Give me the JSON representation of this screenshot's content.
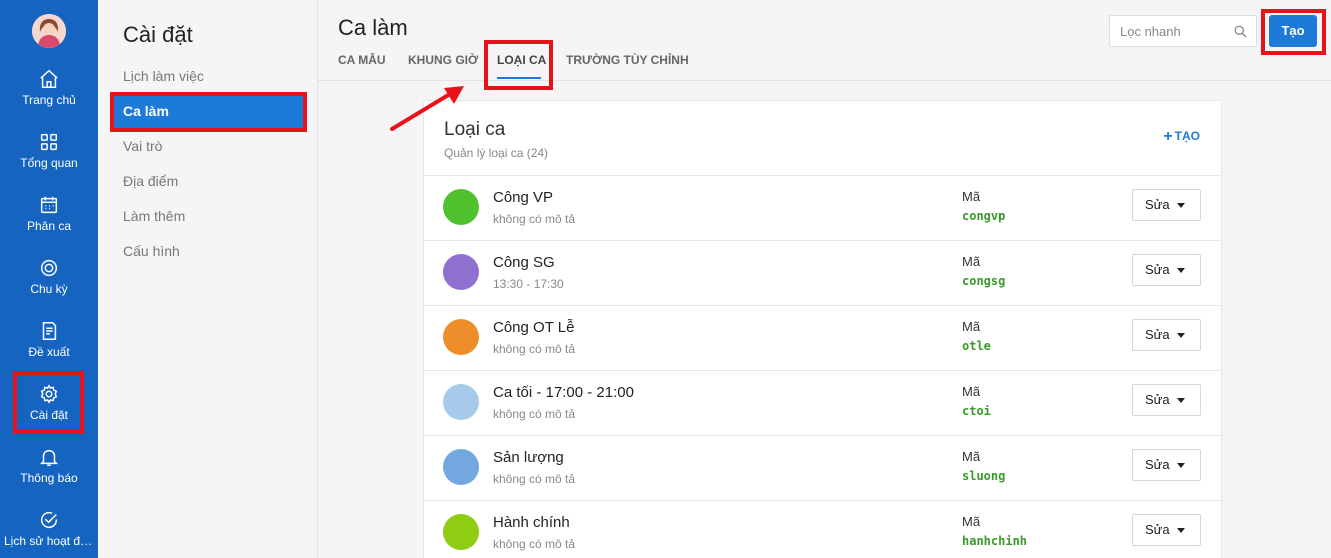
{
  "rail": {
    "items": [
      {
        "label": "Trang chủ",
        "icon": "home-icon"
      },
      {
        "label": "Tổng quan",
        "icon": "grid-icon"
      },
      {
        "label": "Phân ca",
        "icon": "calendar-icon"
      },
      {
        "label": "Chu kỳ",
        "icon": "cycle-icon"
      },
      {
        "label": "Đề xuất",
        "icon": "document-icon"
      },
      {
        "label": "Cài đặt",
        "icon": "gear-icon"
      },
      {
        "label": "Thông báo",
        "icon": "bell-icon"
      },
      {
        "label": "Lịch sử hoạt động",
        "icon": "check-circle-icon"
      }
    ]
  },
  "settings_menu": {
    "title": "Cài đặt",
    "items": [
      {
        "label": "Lịch làm việc"
      },
      {
        "label": "Ca làm"
      },
      {
        "label": "Vai trò"
      },
      {
        "label": "Địa điểm"
      },
      {
        "label": "Làm thêm"
      },
      {
        "label": "Cấu hình"
      }
    ]
  },
  "header": {
    "title": "Ca làm",
    "tabs": [
      {
        "label": "CA MẪU"
      },
      {
        "label": "KHUNG GIỜ"
      },
      {
        "label": "LOẠI CA"
      },
      {
        "label": "TRƯỜNG TÙY CHỈNH"
      }
    ],
    "active_tab": "LOẠI CA",
    "search_placeholder": "Lọc nhanh",
    "create_label": "Tạo"
  },
  "card": {
    "title": "Loại ca",
    "subtitle": "Quản lý loại ca (24)",
    "add_label": "TẠO",
    "code_label": "Mã",
    "edit_label": "Sửa",
    "rows": [
      {
        "name": "Công VP",
        "desc": "không có mô tả",
        "code": "congvp",
        "color": "#4fc12e"
      },
      {
        "name": "Công SG",
        "desc": "13:30 - 17:30",
        "code": "congsg",
        "color": "#8f6fd0"
      },
      {
        "name": "Công OT Lễ",
        "desc": "không có mô tả",
        "code": "otle",
        "color": "#ed8e2a"
      },
      {
        "name": "Ca tối - 17:00 - 21:00",
        "desc": "không có mô tả",
        "code": "ctoi",
        "color": "#a7c9ea"
      },
      {
        "name": "Sản lượng",
        "desc": "không có mô tả",
        "code": "sluong",
        "color": "#72a8df"
      },
      {
        "name": "Hành chính",
        "desc": "không có mô tả",
        "code": "hanhchinh",
        "color": "#8fcd12"
      }
    ]
  },
  "annotation_color": "#e8121b",
  "accent_color": "#1e7ad9",
  "rail_color": "#1565c0"
}
